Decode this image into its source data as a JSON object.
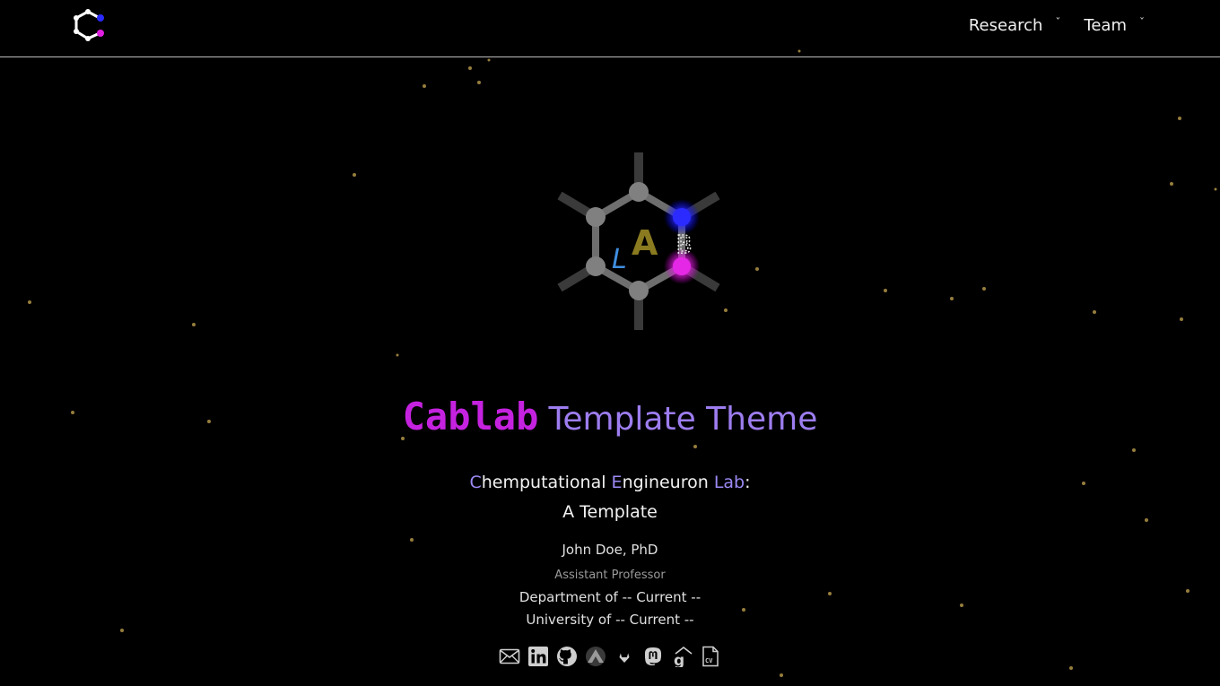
{
  "navbar": {
    "logo_icon": "cablab-hexagon-logo-icon",
    "menu": [
      {
        "label": "Research",
        "caret": "ˇ"
      },
      {
        "label": "Team",
        "caret": "ˇ"
      }
    ]
  },
  "hero": {
    "logo_icon": "lab-hexagon-molecule-icon",
    "logo_letters": {
      "l": "L",
      "a": "A",
      "b": "B"
    },
    "title": {
      "strong": "Cablab",
      "rest": "Template Theme"
    },
    "subtitle": {
      "c": "C",
      "c_rest": "hemputational ",
      "e": "E",
      "e_rest": "ngineuron ",
      "lab": "Lab",
      "colon": ":",
      "line2": "A Template"
    },
    "person": {
      "name": "John Doe, PhD",
      "position": "Assistant Professor",
      "department": "Department of -- Current --",
      "university": "University of -- Current --"
    }
  },
  "social_icons": [
    "email-icon",
    "linkedin-icon",
    "github-icon",
    "orcid-icon",
    "gitlab-icon",
    "mastodon-icon",
    "google-scholar-icon",
    "cv-icon"
  ],
  "colors": {
    "background": "#000000",
    "title_magenta": "#c522e0",
    "title_violet": "#9d7df0",
    "accent_blue": "#2020ff",
    "accent_magenta": "#e020e0",
    "particle": "#c8a850"
  }
}
